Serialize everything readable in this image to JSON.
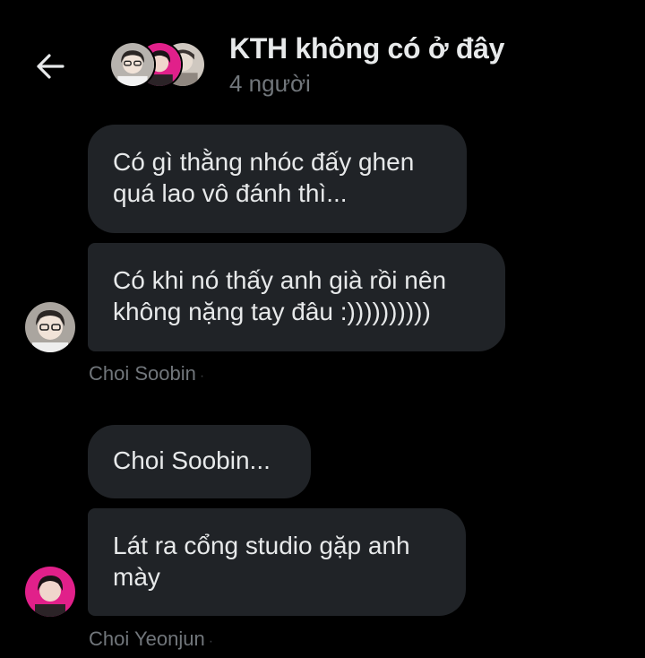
{
  "header": {
    "back_icon": "arrow-left-icon",
    "title": "KTH không có ở đây",
    "subtitle": "4 người",
    "avatars": [
      "group-avatar-1",
      "group-avatar-2",
      "group-avatar-3"
    ]
  },
  "messages": [
    {
      "text": "Có gì thằng nhóc đấy ghen\nquá lao vô đánh thì..."
    },
    {
      "text": "Có khi nó thấy anh già rồi nên\nkhông nặng tay đâu :))))))))))"
    },
    {
      "text": "Choi Soobin..."
    },
    {
      "text": "Lát ra cổng studio gặp anh\nmày"
    }
  ],
  "senders": [
    {
      "name": "Choi Soobin",
      "dot": "·"
    },
    {
      "name": "Choi Yeonjun",
      "dot": "·"
    }
  ],
  "colors": {
    "background": "#000000",
    "bubble": "#202327",
    "text": "#e7e9ea",
    "muted": "#71767b"
  }
}
